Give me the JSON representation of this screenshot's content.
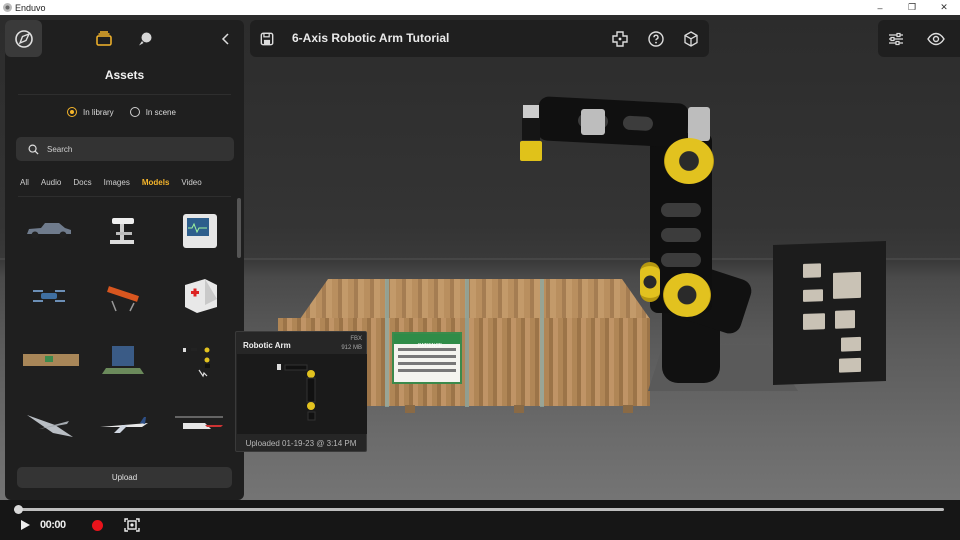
{
  "window": {
    "title": "Enduvo",
    "controls": {
      "minimize": "–",
      "maximize": "❐",
      "close": "✕"
    }
  },
  "header": {
    "title": "6-Axis Robotic Arm Tutorial",
    "icons": [
      "save-icon",
      "move-icon",
      "help-icon",
      "cube-icon"
    ]
  },
  "rightbar": {
    "icons": [
      "sliders-icon",
      "eye-icon"
    ]
  },
  "sidebar": {
    "title": "Assets",
    "top_icons": [
      "compass-logo-icon",
      "layers-icon",
      "paint-icon",
      "chevron-left-icon"
    ],
    "radio": [
      {
        "label": "In library",
        "selected": true
      },
      {
        "label": "In scene",
        "selected": false
      }
    ],
    "search": {
      "placeholder": "Search",
      "value": ""
    },
    "filters": [
      "All",
      "Audio",
      "Docs",
      "Images",
      "Models",
      "Video"
    ],
    "active_filter": "Models",
    "assets": [
      "pickup-truck",
      "microscope",
      "patient-monitor",
      "drone",
      "stretcher",
      "first-aid-box",
      "wooden-crate",
      "machine-on-pallet",
      "robotic-arm",
      "military-drone",
      "airliner",
      "helicopter"
    ],
    "upload_label": "Upload"
  },
  "tooltip": {
    "name": "Robotic Arm",
    "format": "FBX",
    "size": "912 MB",
    "uploaded": "Uploaded 01-19-23 @ 3:14 PM"
  },
  "crate_label": {
    "text": "PATIENCE"
  },
  "playback": {
    "time": "00:00",
    "progress": 0,
    "icons": [
      "play-icon",
      "record-icon",
      "screenshot-icon"
    ]
  },
  "colors": {
    "accent": "#f5b52b",
    "record": "#e8131b",
    "panel": "#1f1f1f",
    "joint": "#e2c21f"
  }
}
